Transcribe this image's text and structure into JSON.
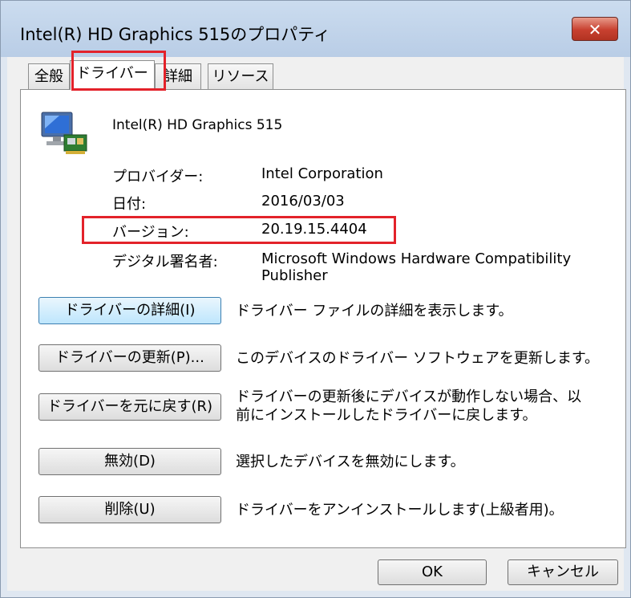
{
  "window": {
    "title": "Intel(R) HD Graphics 515のプロパティ",
    "close_label": "✕"
  },
  "tabs": [
    "全般",
    "ドライバー",
    "詳細",
    "リソース"
  ],
  "device": {
    "name": "Intel(R) HD Graphics 515",
    "icon": "display-adapter-icon"
  },
  "properties": [
    {
      "label": "プロバイダー:",
      "value": "Intel Corporation"
    },
    {
      "label": "日付:",
      "value": "2016/03/03"
    },
    {
      "label": "バージョン:",
      "value": "20.19.15.4404"
    },
    {
      "label": "デジタル署名者:",
      "value": "Microsoft Windows Hardware Compatibility Publisher"
    }
  ],
  "actions": [
    {
      "button": "ドライバーの詳細(I)",
      "description": "ドライバー ファイルの詳細を表示します。"
    },
    {
      "button": "ドライバーの更新(P)...",
      "description": "このデバイスのドライバー ソフトウェアを更新します。"
    },
    {
      "button": "ドライバーを元に戻す(R)",
      "description": "ドライバーの更新後にデバイスが動作しない場合、以前にインストールしたドライバーに戻します。"
    },
    {
      "button": "無効(D)",
      "description": "選択したデバイスを無効にします。"
    },
    {
      "button": "削除(U)",
      "description": "ドライバーをアンインストールします(上級者用)。"
    }
  ],
  "footer": {
    "ok": "OK",
    "cancel": "キャンセル"
  },
  "colors": {
    "highlight": "#e3222a",
    "titlebar": "#c3d5ec",
    "focus_button": "#bee6fd"
  }
}
